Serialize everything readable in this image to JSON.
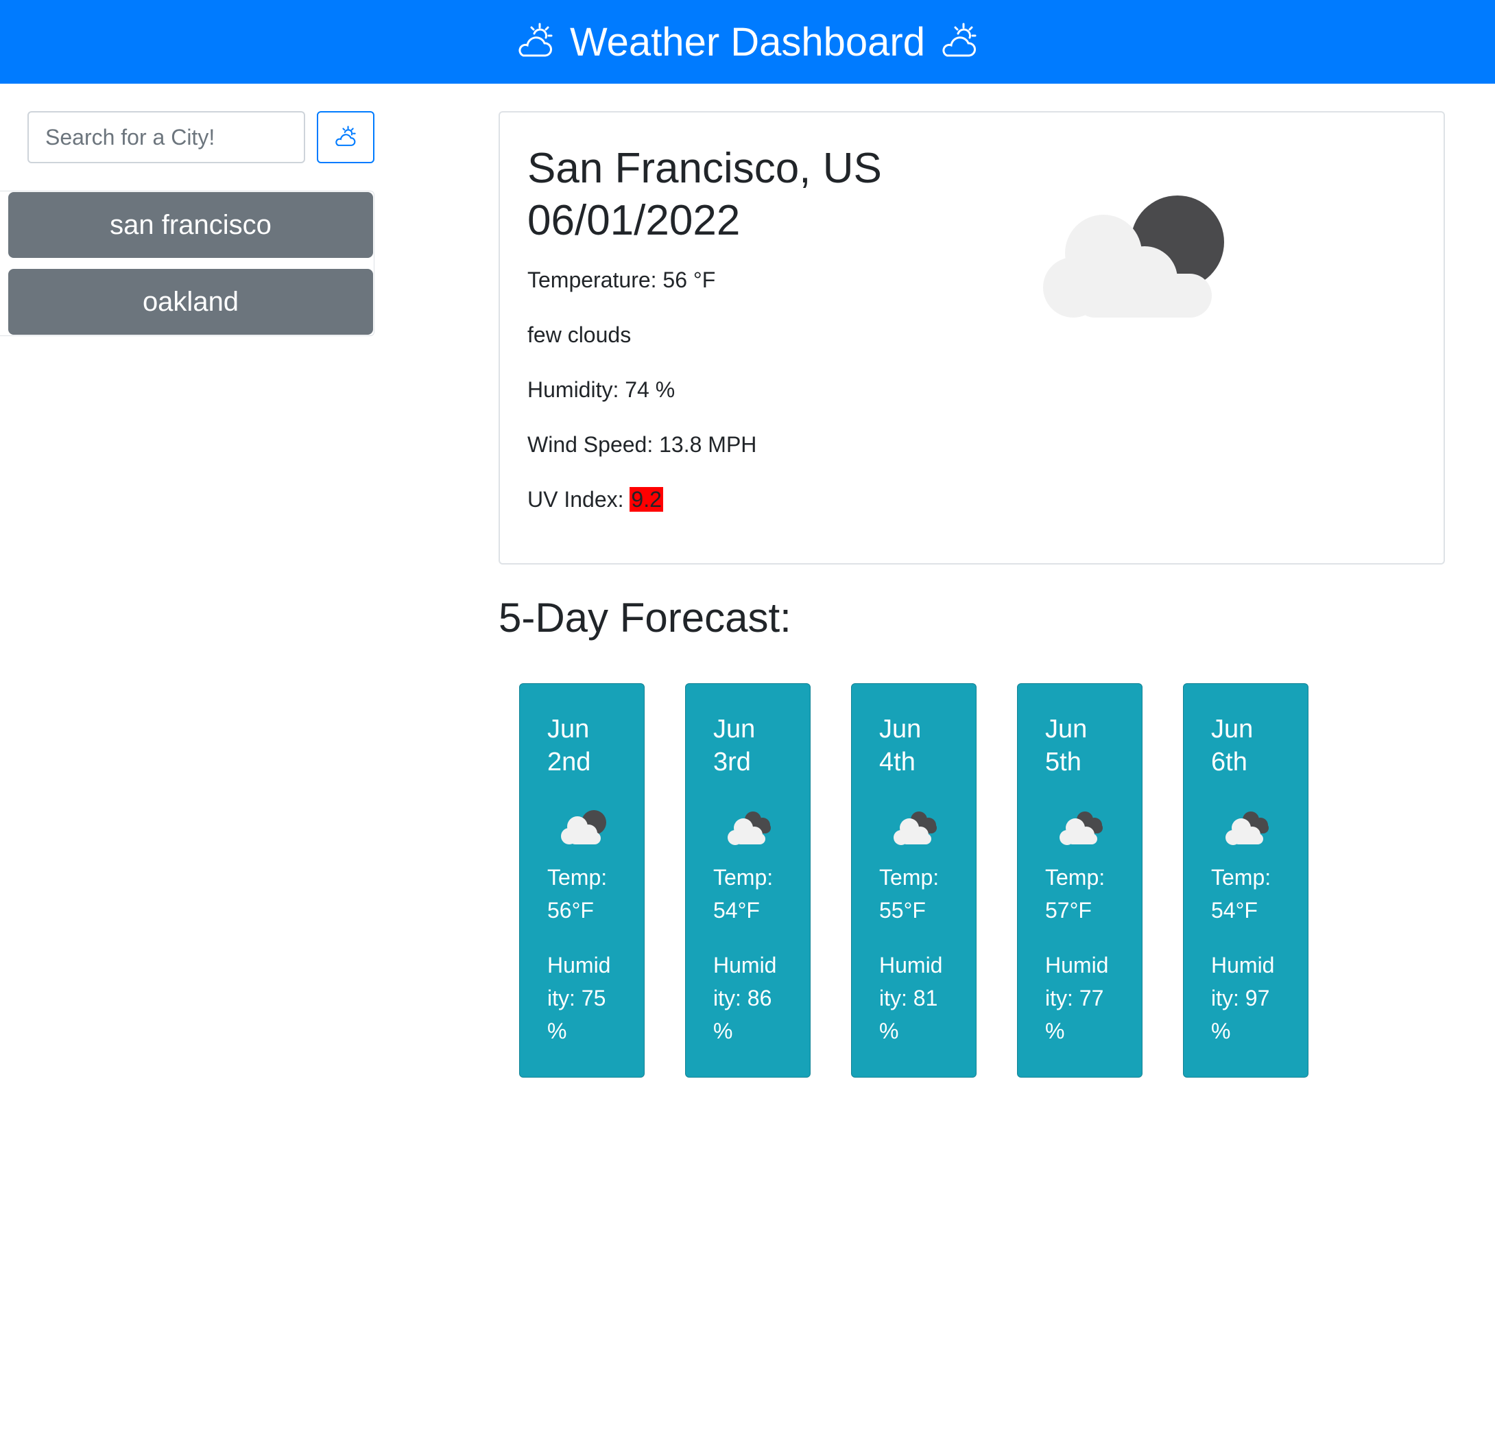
{
  "header": {
    "title": "Weather Dashboard",
    "icon_left": "cloud-sun-icon",
    "icon_right": "cloud-sun-icon"
  },
  "search": {
    "placeholder": "Search for a City!",
    "value": "",
    "button_icon": "cloud-sun-icon"
  },
  "history": {
    "items": [
      {
        "label": "san francisco"
      },
      {
        "label": "oakland"
      }
    ]
  },
  "current": {
    "city": "San Francisco, US",
    "date": "06/01/2022",
    "temperature": "Temperature: 56 °F",
    "description": "few clouds",
    "humidity": "Humidity: 74 %",
    "wind": "Wind Speed: 13.8 MPH",
    "uv_label": "UV Index: ",
    "uv_value": "9.2",
    "uv_color": "#ff0000",
    "icon": "few-clouds-night-icon"
  },
  "forecast": {
    "title": "5-Day Forecast:",
    "days": [
      {
        "month": "Jun",
        "day": "2nd",
        "temp_label": "Temp:",
        "temp": "56°F",
        "hum1": "Humid",
        "hum2": "ity: 75",
        "hum3": "%",
        "icon": "few-clouds-night-icon"
      },
      {
        "month": "Jun",
        "day": "3rd",
        "temp_label": "Temp:",
        "temp": "54°F",
        "hum1": "Humid",
        "hum2": "ity: 86",
        "hum3": "%",
        "icon": "broken-clouds-icon"
      },
      {
        "month": "Jun",
        "day": "4th",
        "temp_label": "Temp:",
        "temp": "55°F",
        "hum1": "Humid",
        "hum2": "ity: 81",
        "hum3": "%",
        "icon": "broken-clouds-icon"
      },
      {
        "month": "Jun",
        "day": "5th",
        "temp_label": "Temp:",
        "temp": "57°F",
        "hum1": "Humid",
        "hum2": "ity: 77",
        "hum3": "%",
        "icon": "broken-clouds-icon"
      },
      {
        "month": "Jun",
        "day": "6th",
        "temp_label": "Temp:",
        "temp": "54°F",
        "hum1": "Humid",
        "hum2": "ity: 97",
        "hum3": "%",
        "icon": "broken-clouds-icon"
      }
    ]
  },
  "colors": {
    "header": "#007bff",
    "history_button": "#6c757d",
    "forecast_card": "#17a2b8",
    "uv_badge": "#ff0000"
  }
}
